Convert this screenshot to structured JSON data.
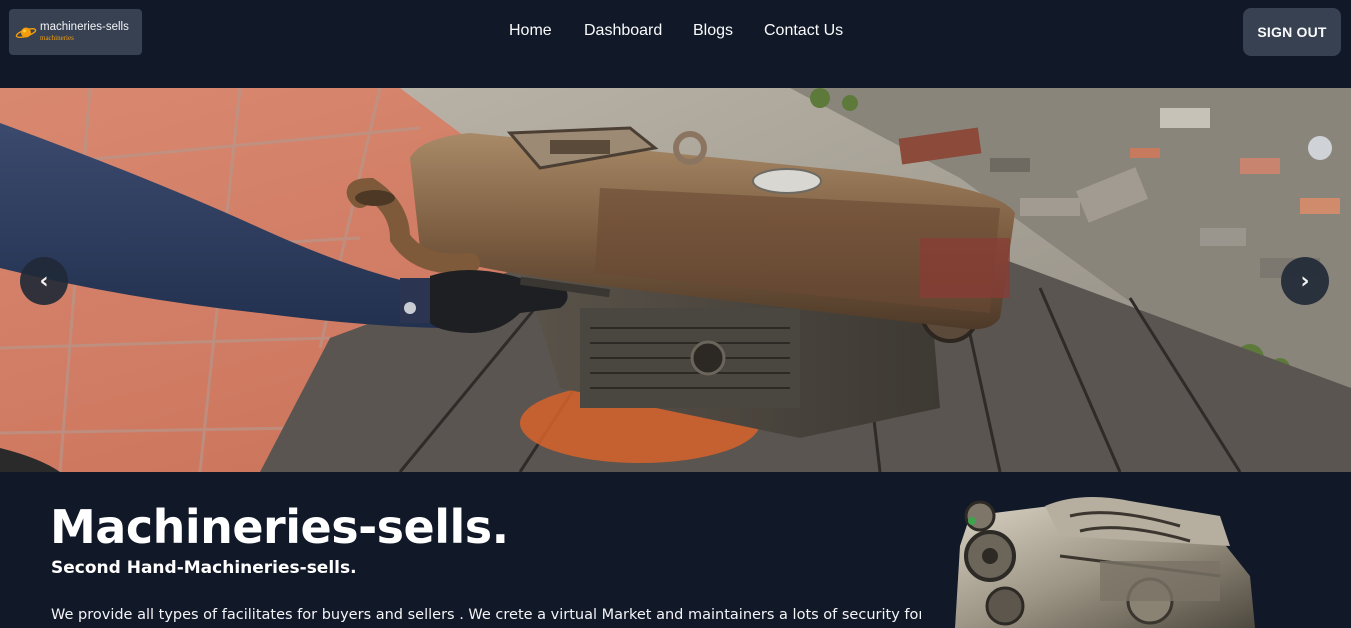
{
  "brand": {
    "name": "machineries-sells",
    "tagline": "machineries",
    "accent_color": "#f59e0b"
  },
  "nav": {
    "links": [
      {
        "label": "Home"
      },
      {
        "label": "Dashboard"
      },
      {
        "label": "Blogs"
      },
      {
        "label": "Contact Us"
      }
    ],
    "signout_label": "SIGN OUT"
  },
  "carousel": {
    "prev_label": "‹",
    "next_label": "›",
    "slide_description": "Person restoring a rusty diesel engine on wooden pallet"
  },
  "hero": {
    "title": "Machineries-sells.",
    "subtitle": "Second Hand-Machineries-sells.",
    "description": "We provide all types of facilitates for buyers and sellers . We crete a virtual Market and maintainers a lots of security for"
  },
  "colors": {
    "background": "#111827",
    "button_bg": "#374151",
    "carousel_button": "#1f2937"
  }
}
